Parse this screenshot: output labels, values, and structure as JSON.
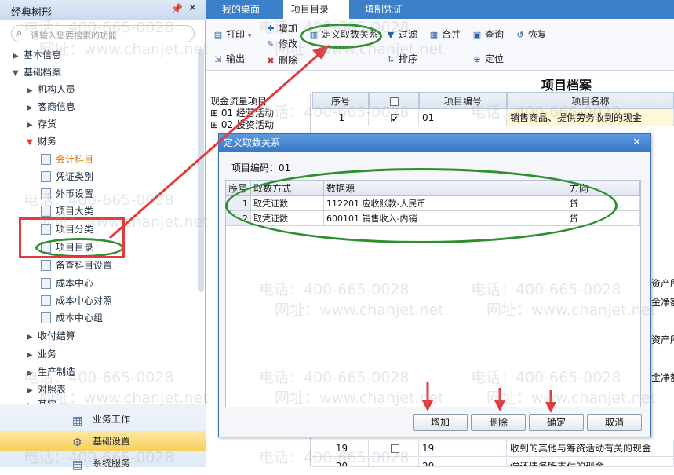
{
  "left_panel": {
    "title": "经典树形",
    "search_placeholder": "请输入您要搜索的功能",
    "tree": [
      {
        "label": "基本信息",
        "state": "collapsed"
      },
      {
        "label": "基础档案",
        "state": "expanded"
      },
      {
        "label": "机构人员",
        "state": "collapsed"
      },
      {
        "label": "客商信息",
        "state": "collapsed"
      },
      {
        "label": "存货",
        "state": "collapsed"
      },
      {
        "label": "财务",
        "state": "expanded"
      },
      {
        "label": "会计科目",
        "state": "leaf"
      },
      {
        "label": "凭证类别",
        "state": "leaf"
      },
      {
        "label": "外币设置",
        "state": "leaf"
      },
      {
        "label": "项目大类",
        "state": "leaf"
      },
      {
        "label": "项目分类",
        "state": "leaf"
      },
      {
        "label": "项目目录",
        "state": "leaf"
      },
      {
        "label": "备查科目设置",
        "state": "leaf"
      },
      {
        "label": "成本中心",
        "state": "leaf"
      },
      {
        "label": "成本中心对照",
        "state": "leaf"
      },
      {
        "label": "成本中心组",
        "state": "leaf"
      },
      {
        "label": "收付结算",
        "state": "collapsed"
      },
      {
        "label": "业务",
        "state": "collapsed"
      },
      {
        "label": "生产制造",
        "state": "collapsed"
      },
      {
        "label": "对照表",
        "state": "collapsed"
      },
      {
        "label": "其它",
        "state": "collapsed"
      }
    ],
    "bottom_nav": [
      {
        "label": "业务工作",
        "icon": "business-icon"
      },
      {
        "label": "基础设置",
        "icon": "gear-icon",
        "active": true
      },
      {
        "label": "系统服务",
        "icon": "service-icon"
      }
    ]
  },
  "tabs": [
    {
      "label": "我的桌面"
    },
    {
      "label": "项目目录",
      "active": true,
      "close": "×"
    },
    {
      "label": "填制凭证"
    }
  ],
  "toolbar": {
    "print": "打印",
    "export": "输出",
    "add": "增加",
    "modify": "修改",
    "delete": "删除",
    "define_relation": "定义取数关系",
    "filter": "过滤",
    "sort": "排序",
    "merge": "合并",
    "query": "查询",
    "locate": "定位",
    "restore": "恢复"
  },
  "page": {
    "title": "项目档案",
    "tree": [
      "现金流量项目",
      "01 经营活动",
      "02 投资活动"
    ],
    "grid_headers": [
      "序号",
      "",
      "项目编号",
      "项目名称"
    ],
    "rows": [
      {
        "no": "1",
        "checked": true,
        "code": "01",
        "name": "销售商品、提供劳务收到的现金"
      },
      {
        "no": "19",
        "checked": false,
        "code": "19",
        "name": "收到的其他与筹资活动有关的现金"
      },
      {
        "no": "20",
        "checked": false,
        "code": "20",
        "name": "偿还债务所支付的现金"
      }
    ],
    "side_texts": [
      "资产所",
      "金净额",
      "资产所",
      "金净额"
    ]
  },
  "dialog": {
    "title": "定义取数关系",
    "code_label": "项目编码：",
    "code_value": "01",
    "headers": [
      "序号",
      "取数方式",
      "数据源",
      "方向"
    ],
    "rows": [
      {
        "no": "1",
        "method": "取凭证数",
        "source": "112201 应收账款-人民币",
        "dir": "贷"
      },
      {
        "no": "2",
        "method": "取凭证数",
        "source": "600101 销售收入-内销",
        "dir": "贷"
      }
    ],
    "buttons": {
      "add": "增加",
      "delete": "删除",
      "ok": "确定",
      "cancel": "取消"
    }
  },
  "watermark": {
    "phone": "电话：400-665-0028",
    "site": "网址：www.chanjet.net"
  },
  "colors": {
    "tab_bar": "#3b7fc8",
    "annotation_green": "#2f8f2f",
    "annotation_red": "#e23b3b",
    "selected_leaf": "#e67e00"
  }
}
